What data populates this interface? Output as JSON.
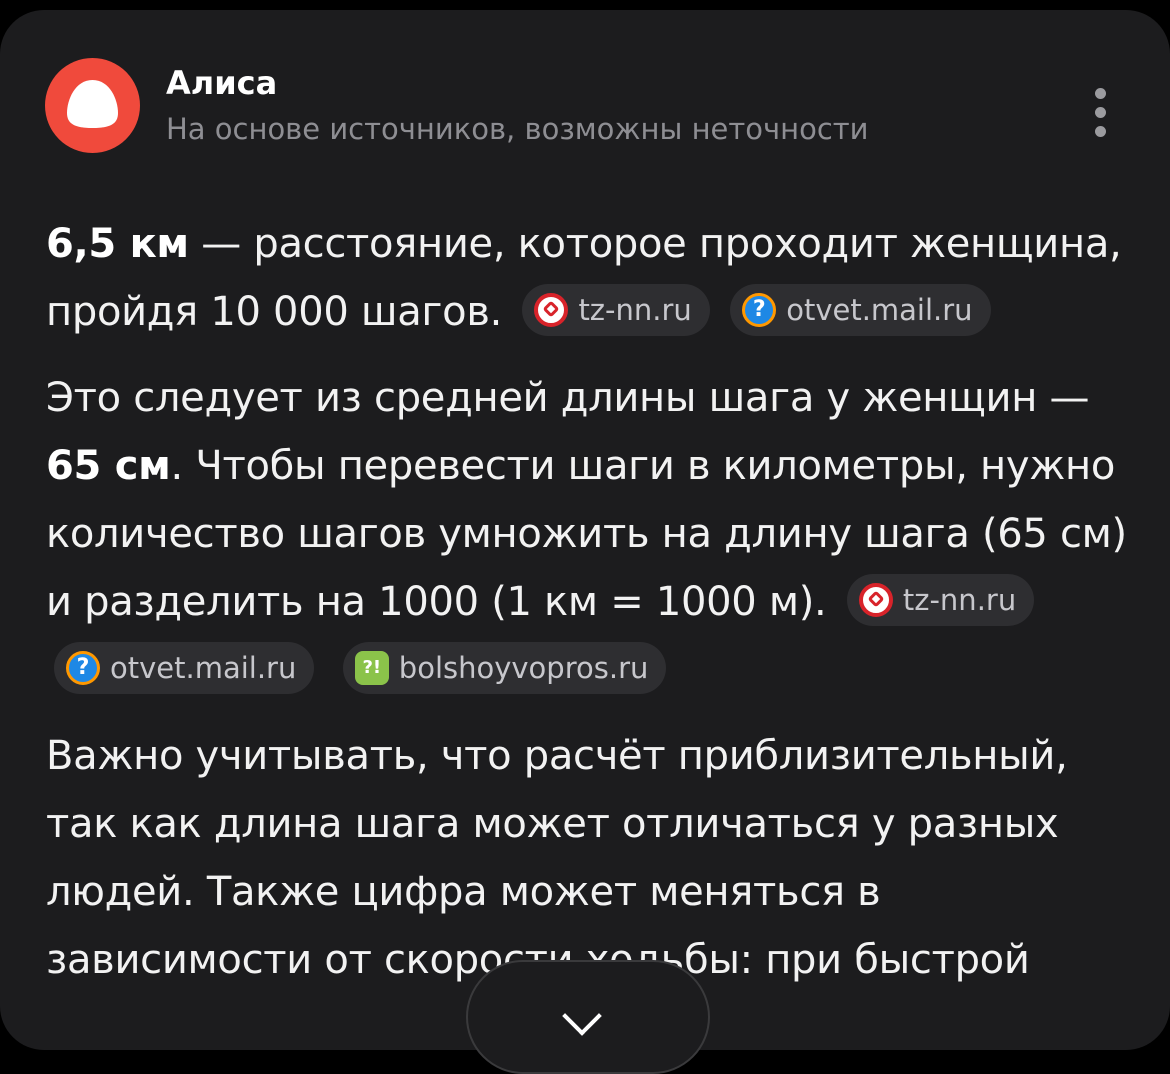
{
  "header": {
    "title": "Алиса",
    "subtitle": "На основе источников, возможны неточности"
  },
  "paragraphs": {
    "p1_bold": "6,5 км",
    "p1_text": " — расстояние, которое проходит женщина, пройдя 10 000 шагов.",
    "p2_text_a": "Это следует из средней длины шага у женщин — ",
    "p2_bold": "65 см",
    "p2_text_b": ". Чтобы перевести шаги в километры, нужно количество шагов умножить на длину шага (65 см) и разделить на 1000 (1 км = 1000 м).",
    "p3_text": "Важно учитывать, что расчёт приблизительный, так как длина шага может отличаться у разных людей. Также цифра может меняться в зависимости от скорости ходьбы: при быстрой"
  },
  "sources": {
    "tz": "tz-nn.ru",
    "mail": "otvet.mail.ru",
    "bv": "bolshoyvopros.ru"
  },
  "icons": {
    "avatar": "alice-logo-icon",
    "menu": "more-vertical-icon",
    "scroll": "chevron-down-icon"
  },
  "colors": {
    "background": "#1c1c1e",
    "alice_red": "#f04a3c",
    "chip_bg": "#2e2e31"
  }
}
